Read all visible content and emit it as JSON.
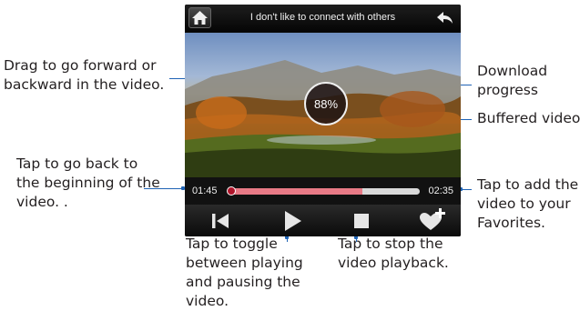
{
  "title_bar": {
    "title": "I don't like to connect with others",
    "home_icon": "home-icon",
    "back_icon": "back-arrow-icon"
  },
  "player": {
    "download_progress_text": "88%",
    "download_progress_fraction": 0.88,
    "elapsed": "01:45",
    "total": "02:35",
    "played_fraction": 0.0,
    "buffered_fraction": 0.7
  },
  "controls": {
    "previous_icon": "skip-to-start-icon",
    "play_icon": "play-icon",
    "stop_icon": "stop-icon",
    "favorite_icon": "add-favorite-icon"
  },
  "callouts": {
    "drag": [
      "Drag to go forward or",
      "backward in the video."
    ],
    "download": [
      "Download",
      "progress"
    ],
    "buffered": [
      "Buffered video"
    ],
    "back": [
      "Tap to go back to",
      "the beginning of the",
      "video. ."
    ],
    "favorites": [
      "Tap to add the",
      "video to your",
      "Favorites."
    ],
    "toggle": [
      "Tap to toggle",
      "between playing",
      "and pausing the",
      "video."
    ],
    "stop": [
      "Tap to stop the",
      "video playback."
    ]
  },
  "colors": {
    "accent_line": "#1f63b5",
    "played": "#c32233",
    "buffered": "#e87a86",
    "track": "#d9d9d9"
  }
}
